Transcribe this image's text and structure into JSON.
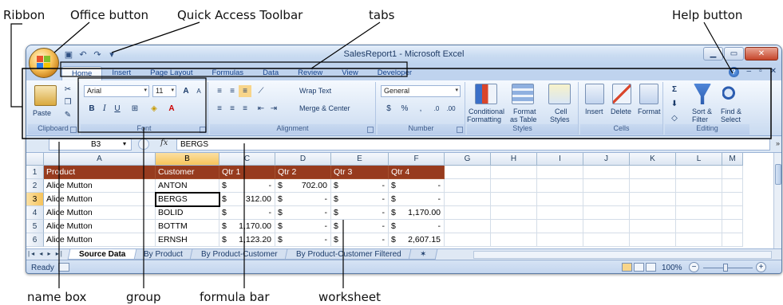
{
  "callouts": {
    "ribbon": "Ribbon",
    "office_button": "Office button",
    "quick_access_toolbar": "Quick Access Toolbar",
    "tabs": "tabs",
    "help_button": "Help button",
    "name_box": "name box",
    "group": "group",
    "formula_bar": "formula bar",
    "worksheet": "worksheet"
  },
  "window": {
    "title": "SalesReport1 - Microsoft Excel"
  },
  "tabs": [
    "Home",
    "Insert",
    "Page Layout",
    "Formulas",
    "Data",
    "Review",
    "View",
    "Developer"
  ],
  "ribbon": {
    "clipboard": {
      "label": "Clipboard",
      "paste": "Paste"
    },
    "font": {
      "label": "Font",
      "name": "Arial",
      "size": "11",
      "bold": "B",
      "italic": "I",
      "underline": "U"
    },
    "alignment": {
      "label": "Alignment",
      "wrap_text": "Wrap Text",
      "merge_center": "Merge & Center"
    },
    "number": {
      "label": "Number",
      "format": "General",
      "currency": "$",
      "percent": "%",
      "comma": ","
    },
    "styles": {
      "label": "Styles",
      "conditional": "Conditional",
      "formatting": "Formatting",
      "format": "Format",
      "as_table": "as Table",
      "cell": "Cell",
      "cell_styles": "Styles"
    },
    "cells": {
      "label": "Cells",
      "insert": "Insert",
      "delete": "Delete",
      "format": "Format"
    },
    "editing": {
      "label": "Editing",
      "sort": "Sort &",
      "filter": "Filter",
      "find": "Find &",
      "select": "Select"
    }
  },
  "formula_bar": {
    "name_box": "B3",
    "fx": "fx",
    "content": "BERGS"
  },
  "grid": {
    "columns": [
      "A",
      "B",
      "C",
      "D",
      "E",
      "F",
      "G",
      "H",
      "I",
      "J",
      "K",
      "L",
      "M"
    ],
    "selected_column": "B",
    "selected_row": "3",
    "row_numbers": [
      "1",
      "2",
      "3",
      "4",
      "5",
      "6"
    ],
    "header_row": [
      "Product",
      "Customer",
      "Qtr 1",
      "Qtr 2",
      "Qtr 3",
      "Qtr 4"
    ],
    "rows": [
      {
        "product": "Alice Mutton",
        "customer": "ANTON",
        "q1": "-",
        "q2": "702.00",
        "q3": "-",
        "q4": "-"
      },
      {
        "product": "Alice Mutton",
        "customer": "BERGS",
        "q1": "312.00",
        "q2": "-",
        "q3": "-",
        "q4": "-"
      },
      {
        "product": "Alice Mutton",
        "customer": "BOLID",
        "q1": "-",
        "q2": "-",
        "q3": "-",
        "q4": "1,170.00"
      },
      {
        "product": "Alice Mutton",
        "customer": "BOTTM",
        "q1": "1,170.00",
        "q2": "-",
        "q3": "-",
        "q4": "-"
      },
      {
        "product": "Alice Mutton",
        "customer": "ERNSH",
        "q1": "1,123.20",
        "q2": "-",
        "q3": "-",
        "q4": "2,607.15"
      }
    ],
    "currency_symbol": "$"
  },
  "sheet_tabs": [
    "Source Data",
    "By Product",
    "By Product-Customer",
    "By Product-Customer Filtered"
  ],
  "status": {
    "ready": "Ready",
    "zoom": "100%",
    "zoom_minus": "−",
    "zoom_plus": "+"
  },
  "colors": {
    "header_fill": "#973b1e",
    "ribbon_blue": "#dbe7f6",
    "selection": "#f6c35a"
  }
}
